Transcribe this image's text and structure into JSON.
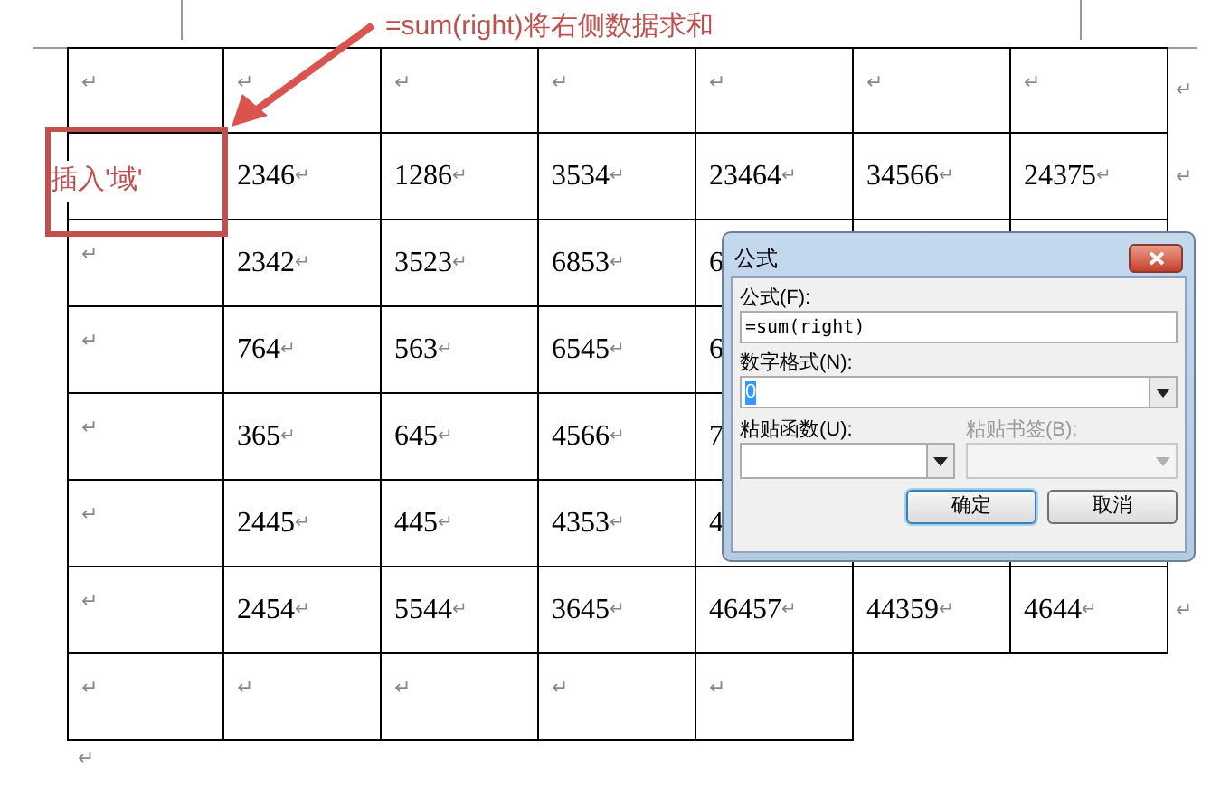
{
  "annotation": {
    "note": "=sum(right)将右侧数据求和",
    "cell_label": "插入'域'"
  },
  "table": {
    "rows": [
      {
        "cells": [
          {
            "end_mark": "↵"
          },
          {
            "end_mark": "↵"
          },
          {
            "end_mark": "↵"
          },
          {
            "end_mark": "↵"
          },
          {
            "end_mark": "↵"
          },
          {
            "end_mark": "↵"
          },
          {
            "end_mark": "↵"
          }
        ],
        "row_end_mark": "↵"
      },
      {
        "cells": [
          {},
          {
            "value": "2346",
            "end_mark": "↵"
          },
          {
            "value": "1286",
            "end_mark": "↵"
          },
          {
            "value": "3534",
            "end_mark": "↵"
          },
          {
            "value": "23464",
            "end_mark": "↵"
          },
          {
            "value": "34566",
            "end_mark": "↵"
          },
          {
            "value": "24375",
            "end_mark": "↵"
          }
        ],
        "row_end_mark": "↵"
      },
      {
        "cells": [
          {
            "end_mark": "↵"
          },
          {
            "value": "2342",
            "end_mark": "↵"
          },
          {
            "value": "3523",
            "end_mark": "↵"
          },
          {
            "value": "6853",
            "end_mark": "↵"
          },
          {
            "value": "6"
          },
          {},
          {}
        ]
      },
      {
        "cells": [
          {
            "end_mark": "↵"
          },
          {
            "value": "764",
            "end_mark": "↵"
          },
          {
            "value": "563",
            "end_mark": "↵"
          },
          {
            "value": "6545",
            "end_mark": "↵"
          },
          {
            "value": "6"
          },
          {},
          {}
        ]
      },
      {
        "cells": [
          {
            "end_mark": "↵"
          },
          {
            "value": "365",
            "end_mark": "↵"
          },
          {
            "value": "645",
            "end_mark": "↵"
          },
          {
            "value": "4566",
            "end_mark": "↵"
          },
          {
            "value": "7"
          },
          {},
          {}
        ]
      },
      {
        "cells": [
          {
            "end_mark": "↵"
          },
          {
            "value": "2445",
            "end_mark": "↵"
          },
          {
            "value": "445",
            "end_mark": "↵"
          },
          {
            "value": "4353",
            "end_mark": "↵"
          },
          {
            "value": "4"
          },
          {},
          {}
        ]
      },
      {
        "cells": [
          {
            "end_mark": "↵"
          },
          {
            "value": "2454",
            "end_mark": "↵"
          },
          {
            "value": "5544",
            "end_mark": "↵"
          },
          {
            "value": "3645",
            "end_mark": "↵"
          },
          {
            "value": "46457",
            "end_mark": "↵"
          },
          {
            "value": "44359",
            "end_mark": "↵"
          },
          {
            "value": "4644",
            "end_mark": "↵"
          }
        ],
        "row_end_mark": "↵"
      },
      {
        "cells": [
          {
            "end_mark": "↵"
          },
          {
            "end_mark": "↵"
          },
          {
            "end_mark": "↵"
          },
          {
            "end_mark": "↵"
          },
          {
            "end_mark": "↵"
          }
        ]
      }
    ]
  },
  "after_table_mark": "↵",
  "dialog": {
    "title": "公式",
    "formula_label": "公式(F):",
    "formula_value": "=sum(right)",
    "number_format_label": "数字格式(N):",
    "number_format_value": "0",
    "number_format_value_selected": true,
    "paste_function_label": "粘贴函数(U):",
    "paste_bookmark_label": "粘贴书签(B):",
    "paste_bookmark_disabled": true,
    "buttons": [
      {
        "label": "确定",
        "default": true
      },
      {
        "label": "取消",
        "default": false
      }
    ]
  }
}
